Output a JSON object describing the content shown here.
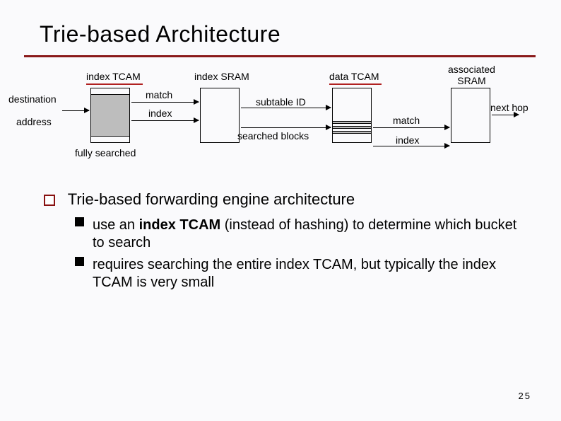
{
  "title": "Trie-based Architecture",
  "diagram": {
    "label_index_tcam": "index TCAM",
    "label_index_sram": "index SRAM",
    "label_data_tcam": "data TCAM",
    "label_associated_sram": "associated\nSRAM",
    "label_destination": "destination",
    "label_address": "address",
    "label_fully_searched": "fully searched",
    "label_match1": "match",
    "label_index1": "index",
    "label_subtable_id": "subtable ID",
    "label_searched_blocks": "searched blocks",
    "label_match2": "match",
    "label_index2": "index",
    "label_next_hop": "next hop"
  },
  "outline": {
    "heading": "Trie-based forwarding engine architecture",
    "items": [
      {
        "prefix": "use an ",
        "bold": "index TCAM",
        "suffix": "  (instead of hashing) to determine which bucket to search"
      },
      {
        "prefix": "",
        "bold": "",
        "suffix": "requires searching the entire index TCAM, but typically the index TCAM is very small"
      }
    ]
  },
  "page_number": "25"
}
